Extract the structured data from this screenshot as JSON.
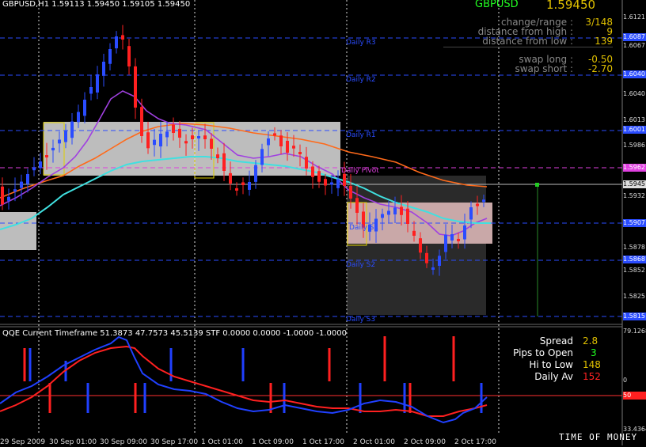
{
  "chart": {
    "header": "GBPUSD,H1  1.59113 1.59450 1.59105 1.59450",
    "symbol": "GBPUSD",
    "price": "1.59450",
    "info_rows": [
      {
        "label": "change/range :",
        "value": "3/148",
        "color": "#e0c000"
      },
      {
        "label": "distance from high :",
        "value": "9",
        "color": "#e0c000"
      },
      {
        "label": "distance from low :",
        "value": "139",
        "color": "#e0c000"
      },
      {
        "label": "swap long :",
        "value": "-0.50",
        "color": "#e0c000"
      },
      {
        "label": "swap short :",
        "value": "-2.70",
        "color": "#e0c000"
      }
    ],
    "levels": [
      {
        "name": "Daily R3",
        "color": "#2a4cff"
      },
      {
        "name": "Daily R2",
        "color": "#2a4cff"
      },
      {
        "name": "Daily R1",
        "color": "#2a4cff"
      },
      {
        "name": "Daily Pivot",
        "color": "#e040e0"
      },
      {
        "name": "Daily S1",
        "color": "#2a4cff"
      },
      {
        "name": "Daily S2",
        "color": "#2a4cff"
      },
      {
        "name": "Daily S3",
        "color": "#2a4cff"
      }
    ],
    "price_axis": [
      "1.6121",
      "1.6067",
      "1.6040",
      "1.6013",
      "1.5986",
      "1.5959",
      "1.5945",
      "1.5932",
      "1.5905",
      "1.5878",
      "1.5852",
      "1.5825"
    ],
    "price_axis_tags": [
      "1.6087",
      "1.6040",
      "1.6001",
      "1.5962",
      "1.5907",
      "1.5868",
      "1.5815"
    ]
  },
  "indicator": {
    "header": "QQE Current Timeframe 51.3873 47.7573 45.5139  STF 0.0000 0.0000 -1.0000 -1.0000",
    "axis": [
      "79.1268",
      "0",
      "50",
      "33.4364"
    ],
    "stats": [
      {
        "label": "Spread",
        "value": "2.8",
        "color": "#e0c000"
      },
      {
        "label": "Pips to Open",
        "value": "3",
        "color": "#22ff22"
      },
      {
        "label": "Hi to Low",
        "value": "148",
        "color": "#e0c000"
      },
      {
        "label": "Daily Av",
        "value": "152",
        "color": "#ff2222"
      }
    ]
  },
  "time_axis": [
    "29 Sep 2009",
    "30 Sep 01:00",
    "30 Sep 09:00",
    "30 Sep 17:00",
    "1 Oct 01:00",
    "1 Oct 09:00",
    "1 Oct 17:00",
    "2 Oct 01:00",
    "2 Oct 09:00",
    "2 Oct 17:00"
  ],
  "watermark": "TIME OF MONEY"
}
